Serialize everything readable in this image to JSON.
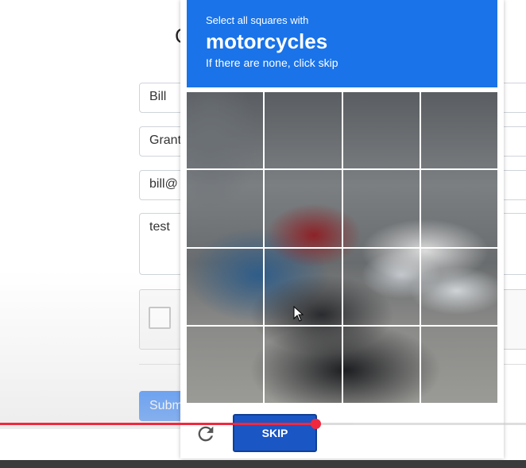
{
  "form": {
    "first_name": "Bill",
    "last_name": "Grant",
    "email": "bill@",
    "message": "test",
    "submit_label": "Subm"
  },
  "challenge": {
    "instruction": "Select all squares with",
    "target": "motorcycles",
    "hint": "If there are none, click skip",
    "skip_label": "SKIP",
    "tiles": [
      1,
      2,
      3,
      4,
      5,
      6,
      7,
      8,
      9,
      10,
      11,
      12,
      13,
      14,
      15,
      16
    ]
  },
  "icons": [
    "reload-icon",
    "audio-icon",
    "info-icon"
  ],
  "video": {
    "progress": 0.6,
    "buffered": 0.67
  },
  "colors": {
    "accent": "#1a73e8",
    "skip": "#1a56c4",
    "progress": "#f0283f"
  }
}
